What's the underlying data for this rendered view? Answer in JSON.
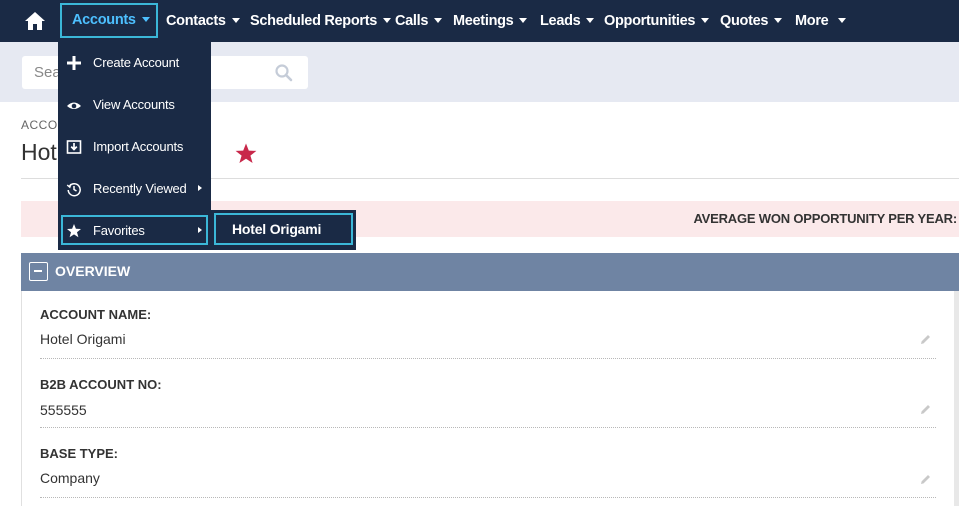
{
  "nav": {
    "home_label": "",
    "items": [
      {
        "label": "Accounts"
      },
      {
        "label": "Contacts"
      },
      {
        "label": "Scheduled Reports"
      },
      {
        "label": "Calls"
      },
      {
        "label": "Meetings"
      },
      {
        "label": "Leads"
      },
      {
        "label": "Opportunities"
      },
      {
        "label": "Quotes"
      },
      {
        "label": "More"
      }
    ]
  },
  "search": {
    "placeholder_visible": "Sea"
  },
  "header": {
    "breadcrumb": "ACCO",
    "title": "Hot"
  },
  "alert": {
    "text": "AVERAGE WON OPPORTUNITY PER YEAR:"
  },
  "overview": {
    "title": "OVERVIEW",
    "fields": [
      {
        "label": "ACCOUNT NAME:",
        "value": "Hotel Origami"
      },
      {
        "label": "B2B ACCOUNT NO:",
        "value": "555555"
      },
      {
        "label": "BASE TYPE:",
        "value": "Company"
      }
    ]
  },
  "dropdown": {
    "items": [
      {
        "label": "Create Account",
        "icon": "plus-icon"
      },
      {
        "label": "View Accounts",
        "icon": "eye-icon"
      },
      {
        "label": "Import Accounts",
        "icon": "import-icon"
      },
      {
        "label": "Recently Viewed",
        "icon": "history-icon"
      },
      {
        "label": "Favorites",
        "icon": "star-icon"
      }
    ],
    "favorites_submenu": [
      "Hotel Origami"
    ]
  },
  "colors": {
    "nav_bg": "#1a2a45",
    "highlight": "#3bb7d8",
    "active_text": "#4dc0ff",
    "favorite_star": "#c8284a",
    "panel_header": "#6f84a3",
    "alert_bg": "#fbe9ea"
  }
}
